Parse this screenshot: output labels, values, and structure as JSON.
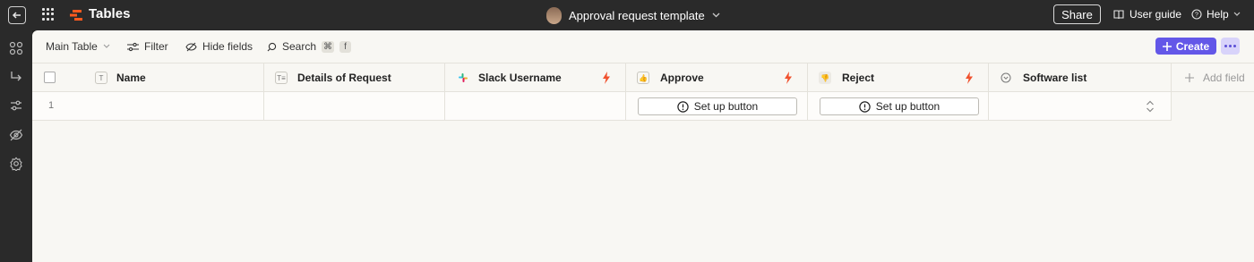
{
  "topbar": {
    "app_title": "Tables",
    "doc_title": "Approval request template",
    "share_label": "Share",
    "user_guide_label": "User guide",
    "help_label": "Help"
  },
  "toolbar": {
    "view_label": "Main Table",
    "filter_label": "Filter",
    "hide_fields_label": "Hide fields",
    "search_label": "Search",
    "search_shortcut_1": "⌘",
    "search_shortcut_2": "f",
    "create_label": "Create"
  },
  "table": {
    "columns": [
      {
        "label": "Name",
        "icon": "text-field-icon"
      },
      {
        "label": "Details of Request",
        "icon": "long-text-field-icon"
      },
      {
        "label": "Slack Username",
        "icon": "slack-icon"
      },
      {
        "label": "Approve",
        "icon": "thumbs-up-icon"
      },
      {
        "label": "Reject",
        "icon": "thumbs-down-icon"
      },
      {
        "label": "Software list",
        "icon": "dropdown-field-icon"
      }
    ],
    "add_field_label": "Add field",
    "rows": [
      {
        "number": "1",
        "approve_button": "Set up button",
        "reject_button": "Set up button"
      }
    ]
  },
  "colors": {
    "accent": "#6357e8",
    "bolt": "#f0512d",
    "background": "#f8f7f3"
  }
}
